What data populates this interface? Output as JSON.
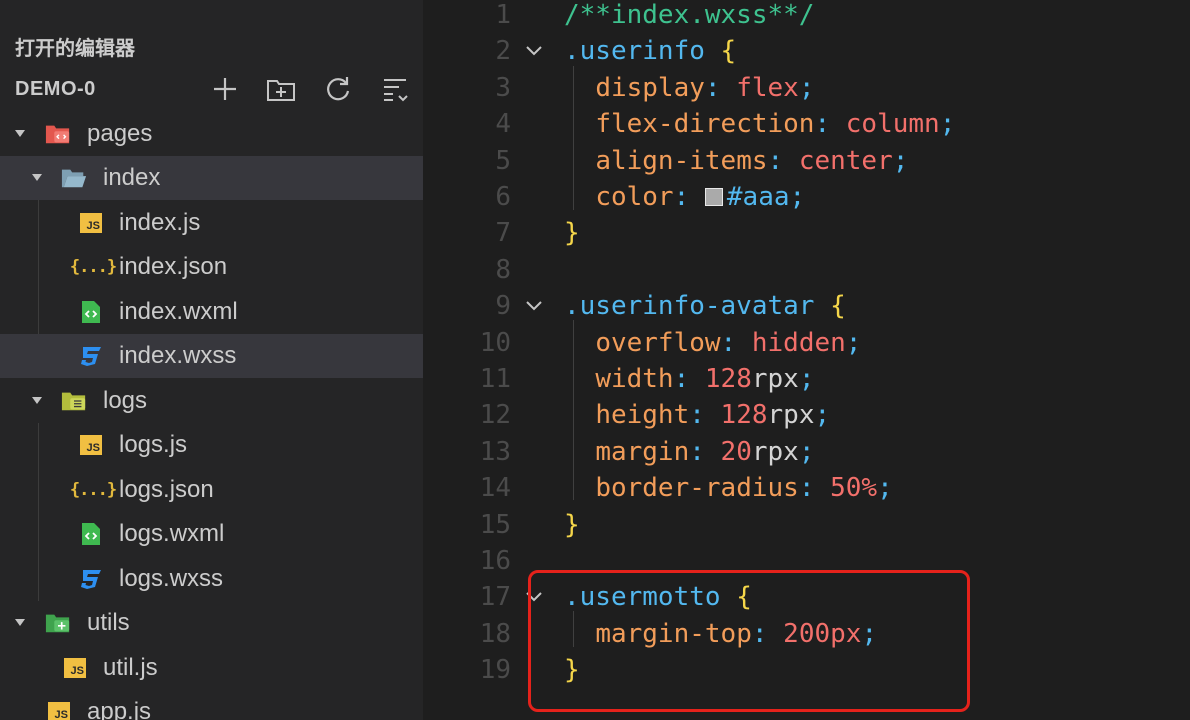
{
  "sidebar": {
    "open_editors_title": "打开的编辑器",
    "project_name": "DEMO-0",
    "toolbar": [
      {
        "name": "new-file-icon"
      },
      {
        "name": "new-folder-icon"
      },
      {
        "name": "refresh-icon"
      },
      {
        "name": "collapse-all-icon"
      }
    ],
    "tree": [
      {
        "label": "pages",
        "icon": "folder-pages-icon",
        "kind": "folder"
      },
      {
        "label": "index",
        "icon": "folder-open-icon",
        "kind": "folder"
      },
      {
        "label": "index.js",
        "icon": "js-file-icon",
        "kind": "file"
      },
      {
        "label": "index.json",
        "icon": "json-file-icon",
        "kind": "file"
      },
      {
        "label": "index.wxml",
        "icon": "wxml-file-icon",
        "kind": "file"
      },
      {
        "label": "index.wxss",
        "icon": "wxss-file-icon",
        "kind": "file"
      },
      {
        "label": "logs",
        "icon": "folder-logs-icon",
        "kind": "folder"
      },
      {
        "label": "logs.js",
        "icon": "js-file-icon",
        "kind": "file"
      },
      {
        "label": "logs.json",
        "icon": "json-file-icon",
        "kind": "file"
      },
      {
        "label": "logs.wxml",
        "icon": "wxml-file-icon",
        "kind": "file"
      },
      {
        "label": "logs.wxss",
        "icon": "wxss-file-icon",
        "kind": "file"
      },
      {
        "label": "utils",
        "icon": "folder-utils-icon",
        "kind": "folder"
      },
      {
        "label": "util.js",
        "icon": "js-file-icon",
        "kind": "file"
      },
      {
        "label": "app.js",
        "icon": "js-file-icon",
        "kind": "file"
      }
    ],
    "js_badge": "JS",
    "json_badge": "{...}"
  },
  "editor": {
    "lines": [
      {
        "n": "1",
        "tokens": [
          [
            "comment",
            "/**index.wxss**/"
          ]
        ]
      },
      {
        "n": "2",
        "fold": true,
        "tokens": [
          [
            "sel",
            ".userinfo"
          ],
          [
            "plain",
            " "
          ],
          [
            "brace",
            "{"
          ]
        ]
      },
      {
        "n": "3",
        "tokens": [
          [
            "plain",
            "  "
          ],
          [
            "prop",
            "display"
          ],
          [
            "semi",
            ": "
          ],
          [
            "val",
            "flex"
          ],
          [
            "semi",
            ";"
          ]
        ]
      },
      {
        "n": "4",
        "tokens": [
          [
            "plain",
            "  "
          ],
          [
            "prop",
            "flex-direction"
          ],
          [
            "semi",
            ": "
          ],
          [
            "val",
            "column"
          ],
          [
            "semi",
            ";"
          ]
        ]
      },
      {
        "n": "5",
        "tokens": [
          [
            "plain",
            "  "
          ],
          [
            "prop",
            "align-items"
          ],
          [
            "semi",
            ": "
          ],
          [
            "val",
            "center"
          ],
          [
            "semi",
            ";"
          ]
        ]
      },
      {
        "n": "6",
        "tokens": [
          [
            "plain",
            "  "
          ],
          [
            "prop",
            "color"
          ],
          [
            "semi",
            ": "
          ],
          [
            "swatch",
            ""
          ],
          [
            "hex",
            "#aaa"
          ],
          [
            "semi",
            ";"
          ]
        ]
      },
      {
        "n": "7",
        "tokens": [
          [
            "brace",
            "}"
          ]
        ]
      },
      {
        "n": "8",
        "tokens": []
      },
      {
        "n": "9",
        "fold": true,
        "tokens": [
          [
            "sel",
            ".userinfo-avatar"
          ],
          [
            "plain",
            " "
          ],
          [
            "brace",
            "{"
          ]
        ]
      },
      {
        "n": "10",
        "tokens": [
          [
            "plain",
            "  "
          ],
          [
            "prop",
            "overflow"
          ],
          [
            "semi",
            ": "
          ],
          [
            "val",
            "hidden"
          ],
          [
            "semi",
            ";"
          ]
        ]
      },
      {
        "n": "11",
        "tokens": [
          [
            "plain",
            "  "
          ],
          [
            "prop",
            "width"
          ],
          [
            "semi",
            ": "
          ],
          [
            "num",
            "128"
          ],
          [
            "unit",
            "rpx"
          ],
          [
            "semi",
            ";"
          ]
        ]
      },
      {
        "n": "12",
        "tokens": [
          [
            "plain",
            "  "
          ],
          [
            "prop",
            "height"
          ],
          [
            "semi",
            ": "
          ],
          [
            "num",
            "128"
          ],
          [
            "unit",
            "rpx"
          ],
          [
            "semi",
            ";"
          ]
        ]
      },
      {
        "n": "13",
        "tokens": [
          [
            "plain",
            "  "
          ],
          [
            "prop",
            "margin"
          ],
          [
            "semi",
            ": "
          ],
          [
            "num",
            "20"
          ],
          [
            "unit",
            "rpx"
          ],
          [
            "semi",
            ";"
          ]
        ]
      },
      {
        "n": "14",
        "tokens": [
          [
            "plain",
            "  "
          ],
          [
            "prop",
            "border-radius"
          ],
          [
            "semi",
            ": "
          ],
          [
            "num",
            "50%"
          ],
          [
            "semi",
            ";"
          ]
        ]
      },
      {
        "n": "15",
        "tokens": [
          [
            "brace",
            "}"
          ]
        ]
      },
      {
        "n": "16",
        "tokens": []
      },
      {
        "n": "17",
        "fold": true,
        "tokens": [
          [
            "sel",
            ".usermotto"
          ],
          [
            "plain",
            " "
          ],
          [
            "brace",
            "{"
          ]
        ]
      },
      {
        "n": "18",
        "tokens": [
          [
            "plain",
            "  "
          ],
          [
            "prop",
            "margin-top"
          ],
          [
            "semi",
            ": "
          ],
          [
            "num",
            "200px"
          ],
          [
            "semi",
            ";"
          ]
        ]
      },
      {
        "n": "19",
        "tokens": [
          [
            "brace",
            "}"
          ]
        ]
      }
    ]
  },
  "colors": {
    "background": "#1e1e1e",
    "sidebar": "#252526",
    "selection": "#37373d",
    "highlight_box": "#e5221b"
  }
}
